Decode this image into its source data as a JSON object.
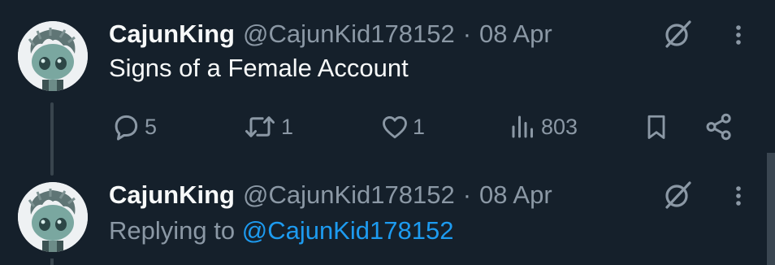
{
  "tweets": [
    {
      "display_name": "CajunKing",
      "handle": "@CajunKid178152",
      "separator": "·",
      "date": "08 Apr",
      "text": "Signs of a Female Account",
      "actions": {
        "replies": "5",
        "reposts": "1",
        "likes": "1",
        "views": "803"
      }
    },
    {
      "display_name": "CajunKing",
      "handle": "@CajunKid178152",
      "separator": "·",
      "date": "08 Apr",
      "replying_prefix": "Replying to",
      "replying_to": "@CajunKid178152"
    }
  ],
  "icons": {
    "avatar": "funko-figure-avatar",
    "grok": "grok-slash-icon",
    "more": "more-vertical-icon",
    "reply": "reply-bubble-icon",
    "repost": "repost-icon",
    "like": "heart-icon",
    "views": "views-bars-icon",
    "bookmark": "bookmark-icon",
    "share": "share-icon"
  },
  "colors": {
    "background": "#15202b",
    "primary_text": "#f7f9f9",
    "secondary_text": "#8b98a5",
    "link": "#1d9bf0",
    "thread_line": "#38444d"
  }
}
